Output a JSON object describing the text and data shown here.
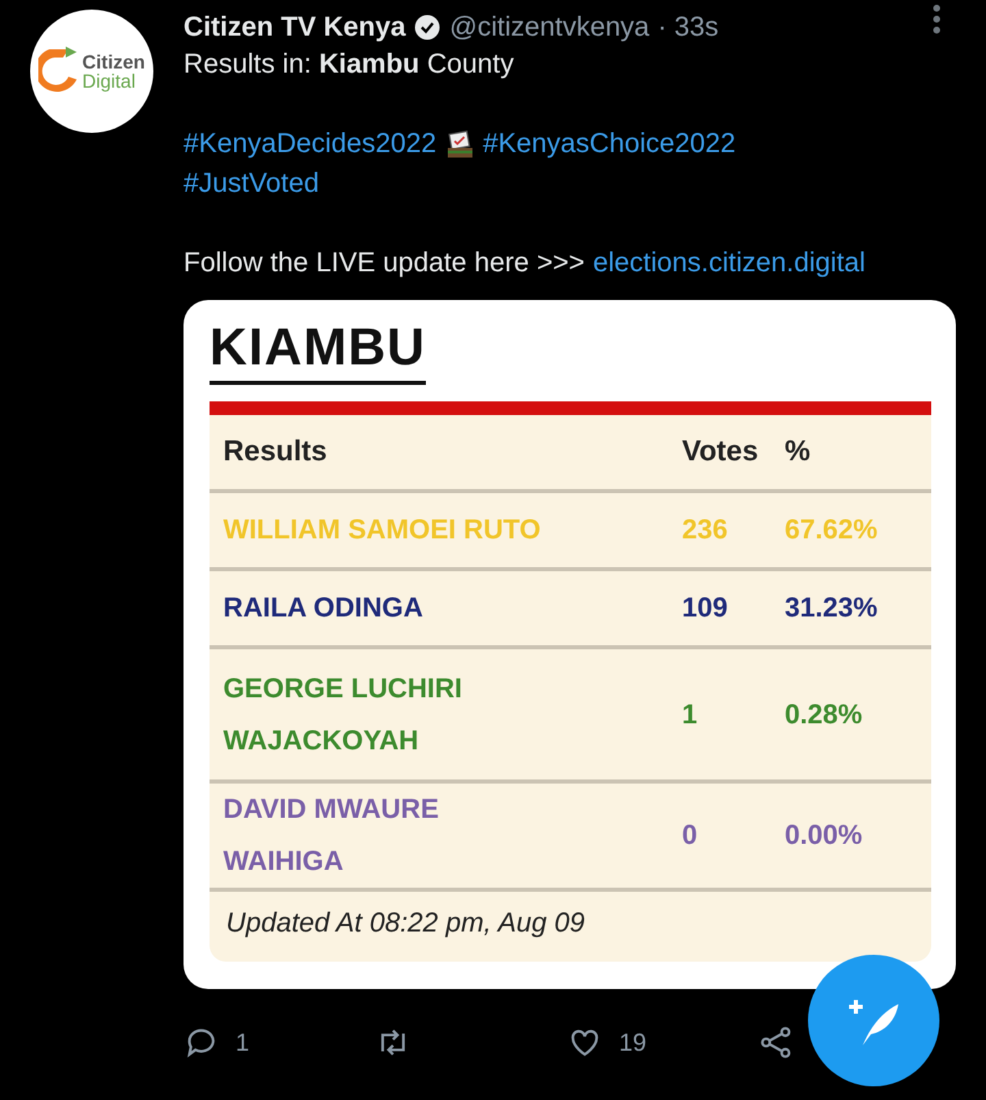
{
  "avatar": {
    "logo_top": "Citizen",
    "logo_bottom": "Digital"
  },
  "tweet": {
    "name": "Citizen TV Kenya",
    "verified": true,
    "handle": "@citizentvkenya",
    "time": "· 33s",
    "lines": [
      {
        "kind": "text",
        "text": "Results in: **Kiambu** County"
      },
      {
        "kind": "blank"
      },
      {
        "kind": "tags",
        "tags": [
          {
            "text": "#KenyaDecides2022",
            "emoji": true
          },
          {
            "text": "#KenyasChoice2022",
            "emoji": false
          }
        ]
      },
      {
        "kind": "tags",
        "tags": [
          {
            "text": "#JustVoted",
            "emoji": false
          }
        ]
      },
      {
        "kind": "blank"
      },
      {
        "kind": "link",
        "text": "Follow the LIVE update here >>>",
        "link": "elections.citizen.digital"
      }
    ]
  },
  "card": {
    "title": "KIAMBU",
    "columns": [
      "Results",
      "Votes",
      "%"
    ],
    "rows": [
      {
        "name": "WILLIAM SAMOEI RUTO",
        "votes": "236",
        "percent": "67.62%",
        "color": "#f1c52a"
      },
      {
        "name": "RAILA ODINGA",
        "votes": "109",
        "percent": "31.23%",
        "color": "#1f2a7a"
      },
      {
        "name": "GEORGE LUCHIRI WAJACKOYAH",
        "votes": "1",
        "percent": "0.28%",
        "color": "#3d8b2e"
      },
      {
        "name": "DAVID MWAURE WAIHIGA",
        "votes": "0",
        "percent": "0.00%",
        "color": "#7a5fa8"
      }
    ],
    "updated": "Updated At 08:22 pm, Aug 09"
  },
  "actions": [
    {
      "kind": "reply",
      "count": "1"
    },
    {
      "kind": "retweet"
    },
    {
      "kind": "like",
      "count": "19"
    },
    {
      "kind": "share"
    }
  ]
}
